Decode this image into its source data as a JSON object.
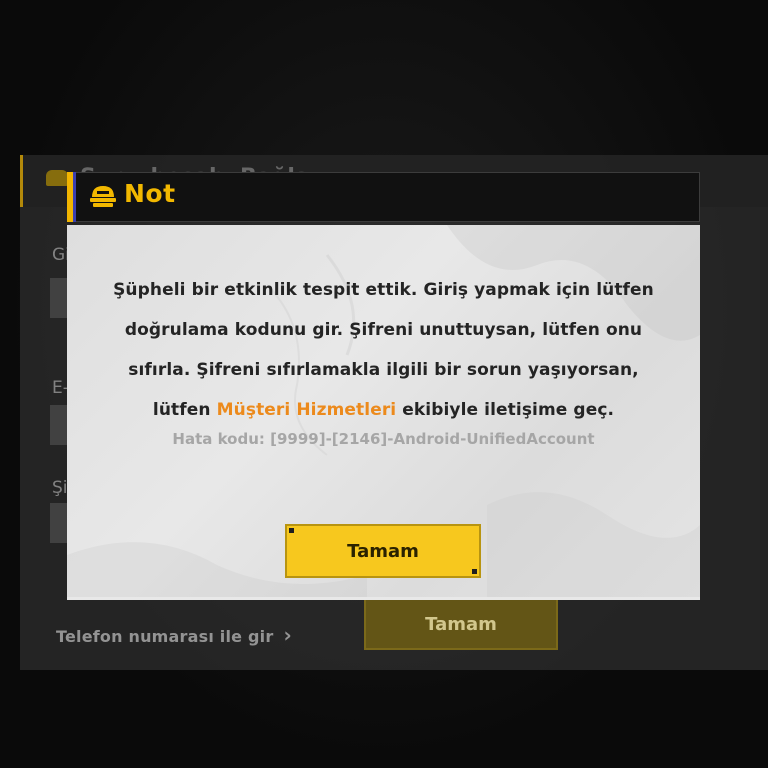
{
  "background": {
    "header_title": "Şunu hesabı Bağla",
    "labels": [
      "Gi",
      "E-",
      "Şi"
    ],
    "phone_link": "Telefon numarası ile gir",
    "ok_label": "Tamam"
  },
  "dialog": {
    "title": "Not",
    "message_parts": {
      "text_before_link": "Şüpheli bir etkinlik tespit ettik. Giriş yapmak için lütfen doğrulama kodunu gir. Şifreni unuttuysan, lütfen onu sıfırla. Şifreni sıfırlamakla ilgili bir sorun yaşıyorsan, lütfen ",
      "link_text": "Müşteri Hizmetleri",
      "text_after_link": " ekibiyle iletişime geç."
    },
    "error_code": "Hata kodu: [9999]-[2146]-Android-UnifiedAccount",
    "ok_label": "Tamam"
  },
  "colors": {
    "accent": "#f2b800",
    "link": "#ec8a1c",
    "button": "#f7c81e"
  }
}
